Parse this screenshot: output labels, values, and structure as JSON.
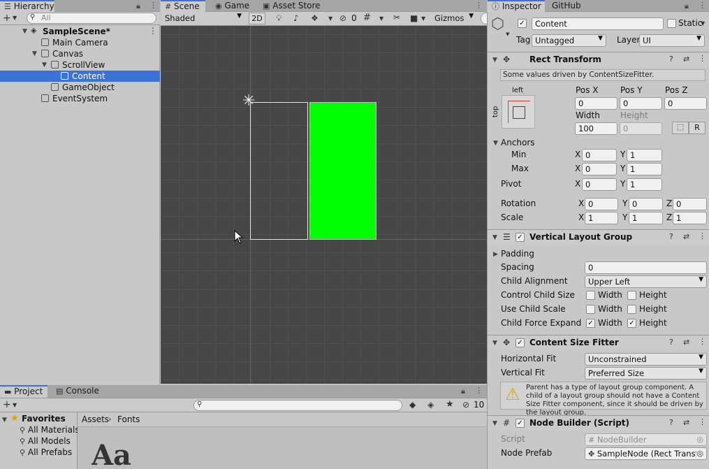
{
  "hierarchy": {
    "tab": "Hierarchy",
    "search_placeholder": "All",
    "items": [
      {
        "label": "SampleScene*"
      },
      {
        "label": "Main Camera"
      },
      {
        "label": "Canvas"
      },
      {
        "label": "ScrollView"
      },
      {
        "label": "Content"
      },
      {
        "label": "GameObject"
      },
      {
        "label": "EventSystem"
      }
    ]
  },
  "scene": {
    "tabs": [
      "Scene",
      "Game",
      "Asset Store"
    ],
    "shading_mode": "Shaded",
    "mode_2d": "2D",
    "hidden_count": "0",
    "gizmos": "Gizmos",
    "colors": {
      "background": "#464646",
      "green_panel": "#00ff00"
    }
  },
  "inspector": {
    "tabs": [
      "Inspector",
      "GitHub"
    ],
    "object_name": "Content",
    "static_label": "Static",
    "tag_label": "Tag",
    "tag_value": "Untagged",
    "layer_label": "Layer",
    "layer_value": "UI",
    "rect_transform": {
      "title": "Rect Transform",
      "driven_note": "Some values driven by ContentSizeFitter.",
      "anchor_h": "left",
      "anchor_v": "top",
      "pos_x_label": "Pos X",
      "pos_y_label": "Pos Y",
      "pos_z_label": "Pos Z",
      "pos_x": "0",
      "pos_y": "0",
      "pos_z": "0",
      "width_label": "Width",
      "height_label": "Height",
      "width": "100",
      "height": "0",
      "r_button": "R",
      "anchors_label": "Anchors",
      "min_label": "Min",
      "max_label": "Max",
      "min_x": "0",
      "min_y": "1",
      "max_x": "0",
      "max_y": "1",
      "pivot_label": "Pivot",
      "pivot_x": "0",
      "pivot_y": "1",
      "rotation_label": "Rotation",
      "rot_x": "0",
      "rot_y": "0",
      "rot_z": "0",
      "scale_label": "Scale",
      "scale_x": "1",
      "scale_y": "1",
      "scale_z": "1",
      "x": "X",
      "y": "Y",
      "z": "Z"
    },
    "vlg": {
      "title": "Vertical Layout Group",
      "padding_label": "Padding",
      "spacing_label": "Spacing",
      "spacing": "0",
      "child_alignment_label": "Child Alignment",
      "child_alignment": "Upper Left",
      "control_child_size_label": "Control Child Size",
      "use_child_scale_label": "Use Child Scale",
      "child_force_expand_label": "Child Force Expand",
      "width": "Width",
      "height": "Height"
    },
    "csf": {
      "title": "Content Size Fitter",
      "horizontal_fit_label": "Horizontal Fit",
      "horizontal_fit": "Unconstrained",
      "vertical_fit_label": "Vertical Fit",
      "vertical_fit": "Preferred Size",
      "warning": "Parent has a type of layout group component. A child of a layout group should not have a Content Size Fitter component, since it should be driven by the layout group."
    },
    "node_builder": {
      "title": "Node Builder (Script)",
      "script_label": "Script",
      "script_value": "NodeBuilder",
      "node_prefab_label": "Node Prefab",
      "node_prefab_value": "SampleNode (Rect Transfo"
    }
  },
  "project": {
    "tabs": [
      "Project",
      "Console"
    ],
    "favorites_label": "Favorites",
    "favorites": [
      "All Materials",
      "All Models",
      "All Prefabs"
    ],
    "breadcrumb": [
      "Assets",
      "Fonts"
    ],
    "hidden_count": "10",
    "font_preview": "Aa"
  }
}
